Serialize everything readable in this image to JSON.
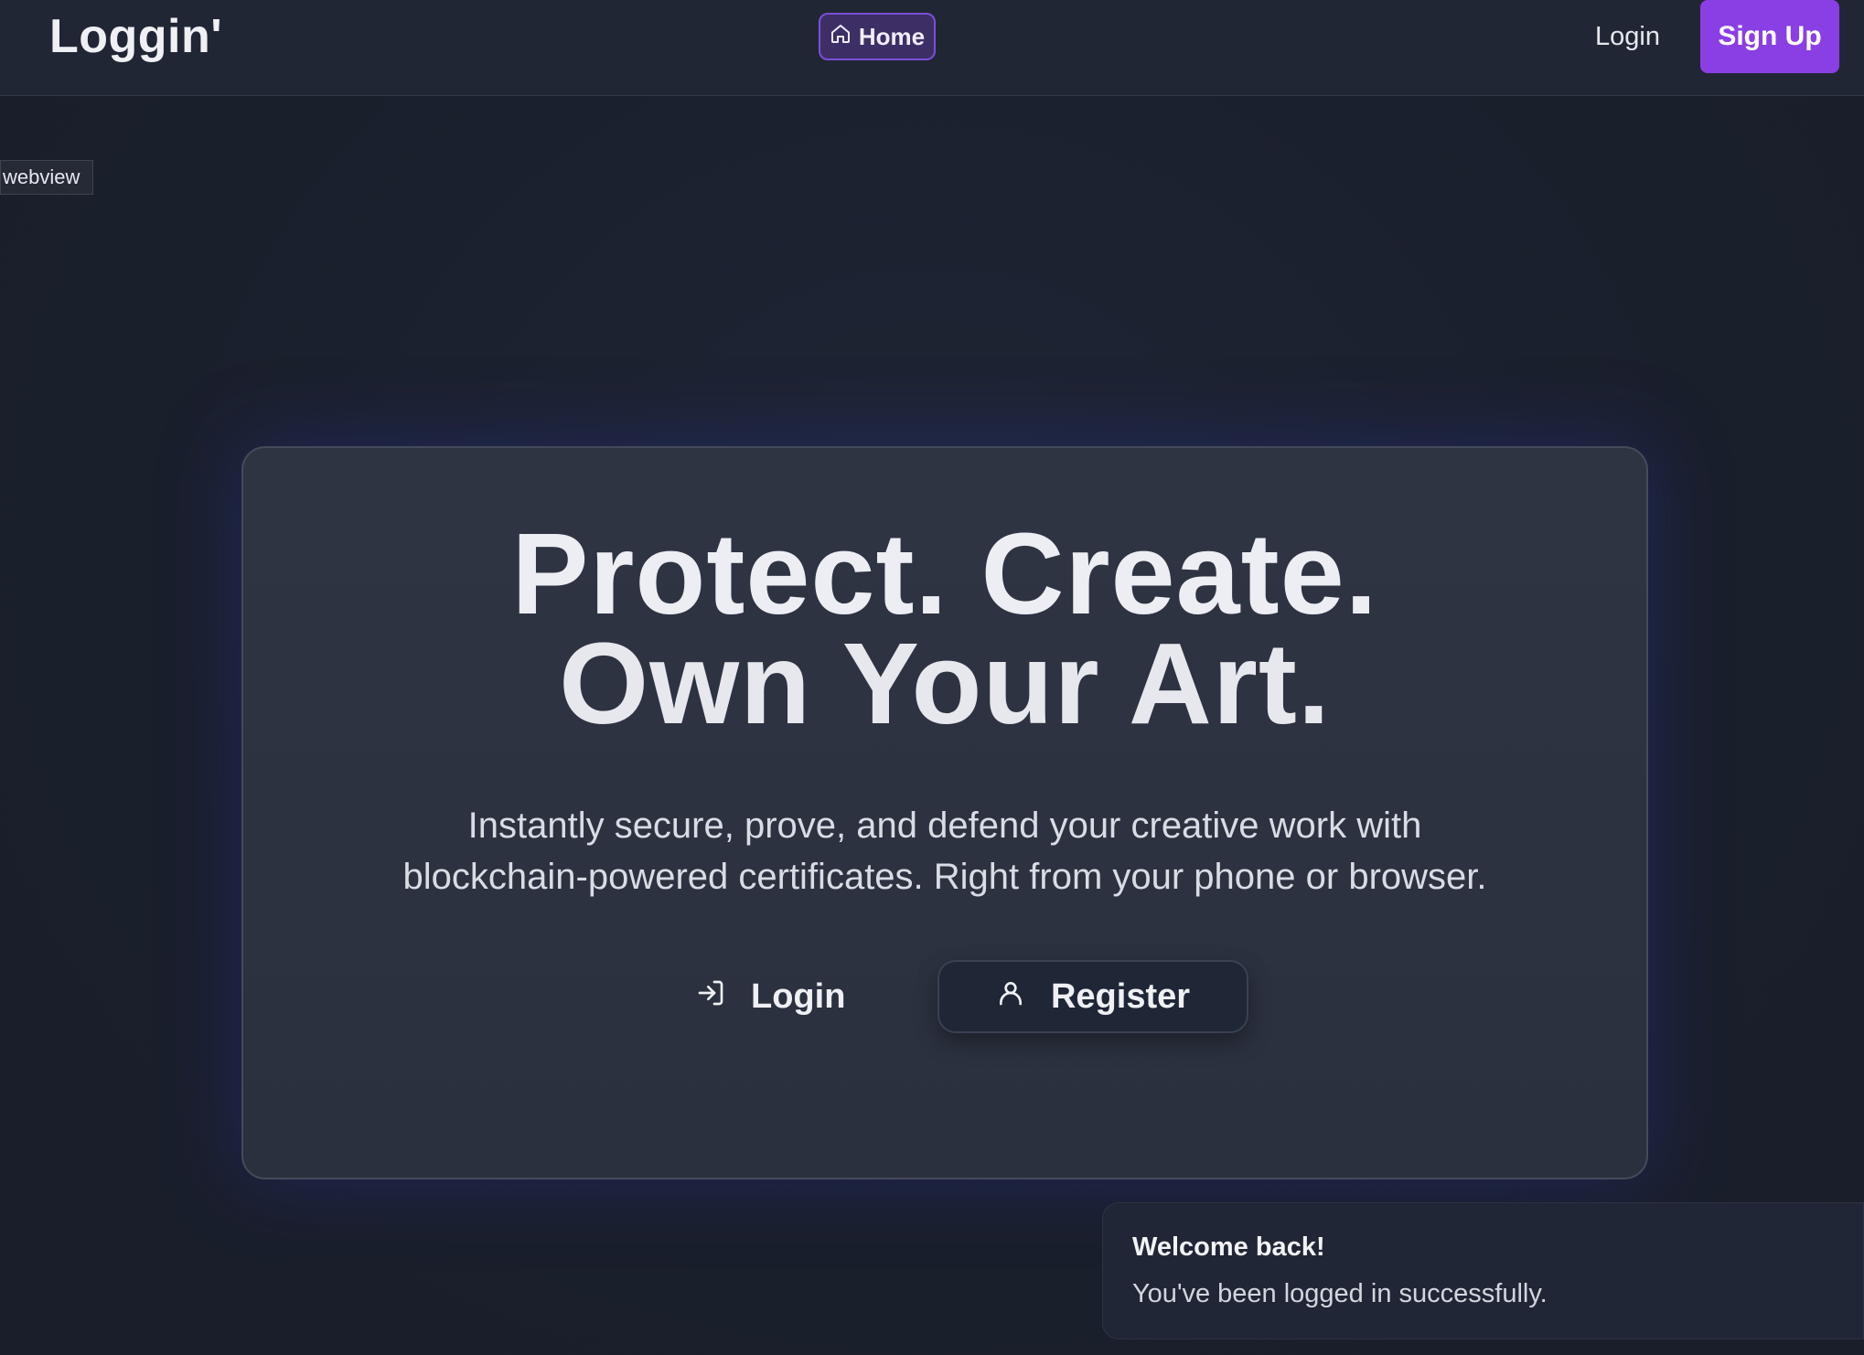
{
  "header": {
    "brand": "Loggin'",
    "nav_home": "Home",
    "nav_login": "Login",
    "signup": "Sign Up"
  },
  "webview_label": "webview",
  "hero": {
    "headline_line1": "Protect. Create.",
    "headline_line2": "Own Your Art.",
    "subtitle_line1": "Instantly secure, prove, and defend your creative work with",
    "subtitle_line2": "blockchain-powered certificates. Right from your phone or browser.",
    "login_label": "Login",
    "register_label": "Register"
  },
  "toast": {
    "title": "Welcome back!",
    "message": "You've been logged in successfully."
  },
  "colors": {
    "accent": "#8a3fe4",
    "background": "#1c2130",
    "card": "#2e3442"
  },
  "icons": {
    "home": "home-icon",
    "login": "log-in-icon",
    "register": "user-icon"
  }
}
